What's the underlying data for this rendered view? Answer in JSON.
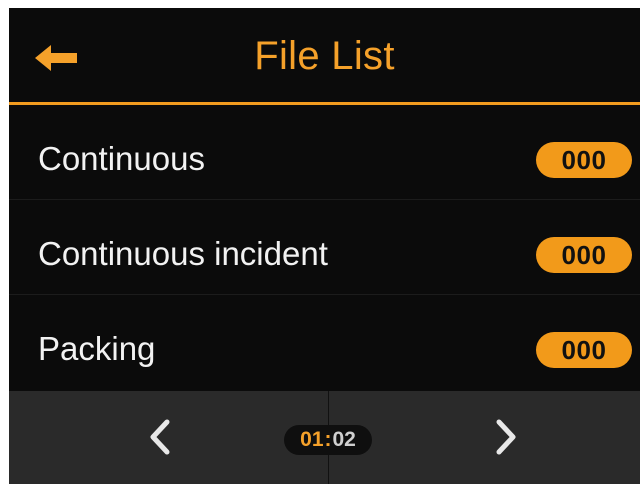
{
  "header": {
    "title": "File List",
    "back_icon": "arrow-left-icon"
  },
  "list": {
    "items": [
      {
        "label": "Continuous",
        "count": "000"
      },
      {
        "label": "Continuous incident",
        "count": "000"
      },
      {
        "label": "Packing",
        "count": "000"
      }
    ]
  },
  "pagination": {
    "current": "01",
    "separator": ":",
    "total": "02",
    "prev_icon": "chevron-left-icon",
    "next_icon": "chevron-right-icon"
  },
  "colors": {
    "accent": "#f5a12a",
    "badge": "#f29a1a",
    "background": "#0b0b0b",
    "footer": "#2a2a2a",
    "text": "#f2f2f2"
  }
}
